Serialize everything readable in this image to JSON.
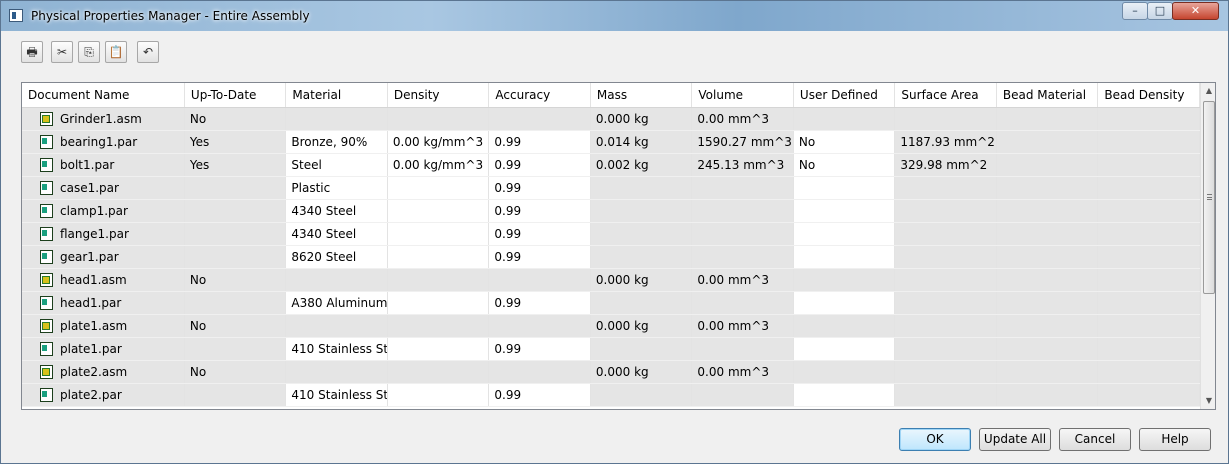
{
  "window": {
    "title": "Physical Properties Manager - Entire Assembly",
    "controls": {
      "minimize": "–",
      "maximize": "□",
      "close": "✕"
    }
  },
  "toolbar": {
    "buttons": [
      {
        "name": "print-icon",
        "glyph": "🖶"
      },
      {
        "name": "cut-icon",
        "glyph": "✂"
      },
      {
        "name": "copy-icon",
        "glyph": "⎘"
      },
      {
        "name": "paste-icon",
        "glyph": "📋"
      },
      {
        "name": "undo-icon",
        "glyph": "↶"
      }
    ]
  },
  "grid": {
    "columns": [
      "Document Name",
      "Up-To-Date",
      "Material",
      "Density",
      "Accuracy",
      "Mass",
      "Volume",
      "User Defined",
      "Surface Area",
      "Bead Material",
      "Bead Density"
    ],
    "rows": [
      {
        "type": "asm",
        "cells": [
          "Grinder1.asm",
          "No",
          "",
          "",
          "",
          "0.000 kg",
          "0.00 mm^3",
          "",
          "",
          "",
          ""
        ]
      },
      {
        "type": "par",
        "cells": [
          "bearing1.par",
          "Yes",
          "Bronze, 90%",
          "0.00 kg/mm^3",
          "0.99",
          "0.014 kg",
          "1590.27 mm^3",
          "No",
          "1187.93 mm^2",
          "",
          ""
        ]
      },
      {
        "type": "par",
        "cells": [
          "bolt1.par",
          "Yes",
          "Steel",
          "0.00 kg/mm^3",
          "0.99",
          "0.002 kg",
          "245.13 mm^3",
          "No",
          "329.98 mm^2",
          "",
          ""
        ]
      },
      {
        "type": "par",
        "cells": [
          "case1.par",
          "",
          "Plastic",
          "",
          "0.99",
          "",
          "",
          "",
          "",
          "",
          ""
        ]
      },
      {
        "type": "par",
        "cells": [
          "clamp1.par",
          "",
          "4340 Steel",
          "",
          "0.99",
          "",
          "",
          "",
          "",
          "",
          ""
        ]
      },
      {
        "type": "par",
        "cells": [
          "flange1.par",
          "",
          "4340 Steel",
          "",
          "0.99",
          "",
          "",
          "",
          "",
          "",
          ""
        ]
      },
      {
        "type": "par",
        "cells": [
          "gear1.par",
          "",
          "8620 Steel",
          "",
          "0.99",
          "",
          "",
          "",
          "",
          "",
          ""
        ]
      },
      {
        "type": "asm",
        "cells": [
          "head1.asm",
          "No",
          "",
          "",
          "",
          "0.000 kg",
          "0.00 mm^3",
          "",
          "",
          "",
          ""
        ]
      },
      {
        "type": "par",
        "cells": [
          "head1.par",
          "",
          "A380 Aluminum",
          "",
          "0.99",
          "",
          "",
          "",
          "",
          "",
          ""
        ]
      },
      {
        "type": "asm",
        "cells": [
          "plate1.asm",
          "No",
          "",
          "",
          "",
          "0.000 kg",
          "0.00 mm^3",
          "",
          "",
          "",
          ""
        ]
      },
      {
        "type": "par",
        "cells": [
          "plate1.par",
          "",
          "410 Stainless St...",
          "",
          "0.99",
          "",
          "",
          "",
          "",
          "",
          ""
        ]
      },
      {
        "type": "asm",
        "cells": [
          "plate2.asm",
          "No",
          "",
          "",
          "",
          "0.000 kg",
          "0.00 mm^3",
          "",
          "",
          "",
          ""
        ]
      },
      {
        "type": "par",
        "cells": [
          "plate2.par",
          "",
          "410 Stainless St...",
          "",
          "0.99",
          "",
          "",
          "",
          "",
          "",
          ""
        ]
      }
    ]
  },
  "scrollbar": {
    "up": "▲",
    "down": "▼"
  },
  "buttons": {
    "ok": "OK",
    "update_all": "Update All",
    "cancel": "Cancel",
    "help": "Help"
  }
}
